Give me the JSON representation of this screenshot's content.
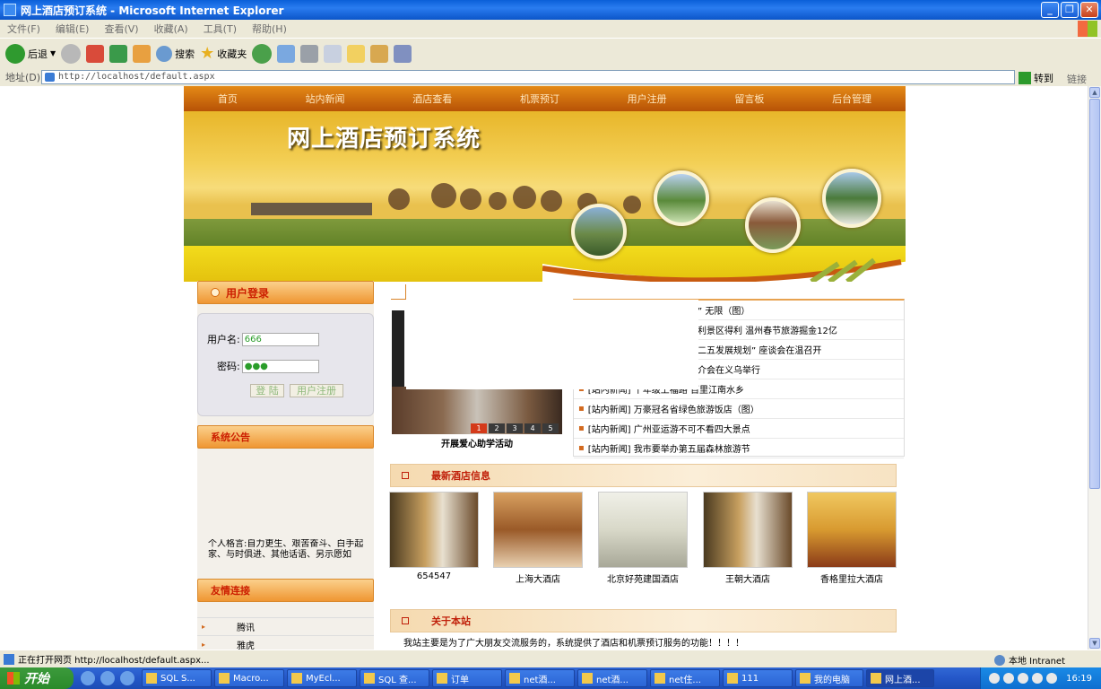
{
  "window": {
    "title": "网上酒店预订系统 - Microsoft Internet Explorer"
  },
  "menu": [
    "文件(F)",
    "编辑(E)",
    "查看(V)",
    "收藏(A)",
    "工具(T)",
    "帮助(H)"
  ],
  "toolbar": {
    "back": "后退",
    "search": "搜索",
    "favorites": "收藏夹"
  },
  "address": {
    "label": "地址(D)",
    "url": "http://localhost/default.aspx",
    "go": "转到",
    "links": "链接"
  },
  "site": {
    "nav": [
      "首页",
      "站内新闻",
      "酒店查看",
      "机票预订",
      "用户注册",
      "留言板",
      "后台管理"
    ],
    "banner_title": "网上酒店预订系统",
    "login": {
      "header": "用户登录",
      "username_label": "用户名:",
      "username_value": "666",
      "password_label": "密码:",
      "password_value": "●●●",
      "login_btn": "登 陆",
      "register_btn": "用户注册"
    },
    "notice_header": "系统公告",
    "notice_text": "个人格言:自力更生、艰苦奋斗、白手起家、与时俱进、其他话语、另示愿如",
    "links_header": "友情连接",
    "links": [
      "腾讯",
      "雅虎"
    ],
    "slide_caption": "开展爱心助学活动",
    "slide_numbers": [
      "1",
      "2",
      "3",
      "4",
      "5"
    ],
    "news": [
      "” 无限（图）",
      "利景区得利 温州春节旅游掘金12亿",
      "二五发展规划” 座谈会在温召开",
      "介会在义乌举行",
      "[站内新闻] 十年级上福路 百里江南水乡",
      "[站内新闻] 万豪冠名省绿色旅游饭店（图）",
      "[站内新闻] 广州亚运游不可不看四大景点",
      "[站内新闻] 我市要举办第五届森林旅游节"
    ],
    "hotels_header": "最新酒店信息",
    "hotels": [
      "654547",
      "上海大酒店",
      "北京好苑建国酒店",
      "王朝大酒店",
      "香格里拉大酒店"
    ],
    "about_header": "关于本站",
    "about_text": "我站主要是为了广大朋友交流服务的，系统提供了酒店和机票预订服务的功能！！！！"
  },
  "status": {
    "text": "正在打开网页 http://localhost/default.aspx...",
    "zone": "本地 Intranet"
  },
  "taskbar": {
    "start": "开始",
    "tasks": [
      "SQL S...",
      "Macro...",
      "MyEcl...",
      "SQL 查...",
      "订单",
      "net酒...",
      "net酒...",
      "net住...",
      "111",
      "我的电脑",
      "网上酒..."
    ],
    "clock": "16:19"
  }
}
